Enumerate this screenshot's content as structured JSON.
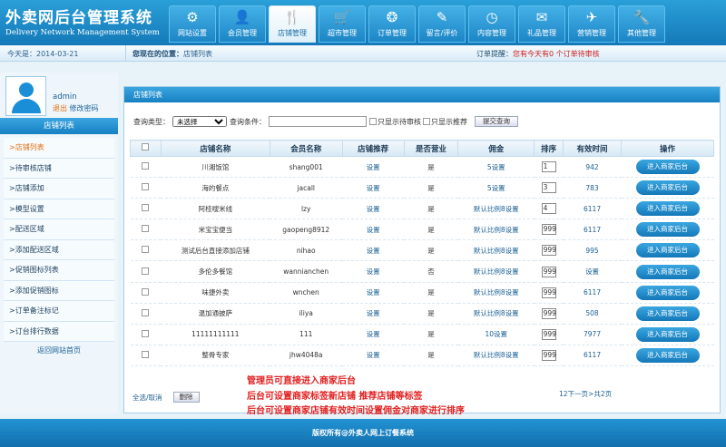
{
  "header": {
    "title": "外卖网后台管理系统",
    "subtitle": "Delivery Network Management System",
    "nav": [
      {
        "label": "网站设置",
        "icon": "gear-icon",
        "glyph": "⚙"
      },
      {
        "label": "会员管理",
        "icon": "user-icon",
        "glyph": "👤"
      },
      {
        "label": "店铺管理",
        "icon": "store-icon",
        "glyph": "🍴",
        "active": true
      },
      {
        "label": "超市管理",
        "icon": "cart-icon",
        "glyph": "🛒"
      },
      {
        "label": "订单管理",
        "icon": "film-icon",
        "glyph": "❂"
      },
      {
        "label": "留言/评价",
        "icon": "message-icon",
        "glyph": "✎"
      },
      {
        "label": "内容管理",
        "icon": "clock-icon",
        "glyph": "◷"
      },
      {
        "label": "礼品管理",
        "icon": "mail-icon",
        "glyph": "✉"
      },
      {
        "label": "营销管理",
        "icon": "plane-icon",
        "glyph": "✈"
      },
      {
        "label": "其他管理",
        "icon": "wrench-icon",
        "glyph": "🔧"
      }
    ]
  },
  "subbar": {
    "date": "今天是：2014-03-21",
    "location_label": "您现在的位置：",
    "location": "店铺列表",
    "notice_prefix": "订单提醒：",
    "notice": "您有今天有0 个订单待审核"
  },
  "sidebar": {
    "username": "admin",
    "logout": "退出",
    "change_password": "修改密码",
    "title": "店铺列表",
    "items": [
      {
        "label": ">店铺列表",
        "active": true
      },
      {
        "label": ">待审核店铺"
      },
      {
        "label": ">店铺添加"
      },
      {
        "label": ">模型设置"
      },
      {
        "label": ">配送区域"
      },
      {
        "label": ">添加配送区域"
      },
      {
        "label": ">促销图标列表"
      },
      {
        "label": ">添加促销图标"
      },
      {
        "label": ">订单备注标记"
      },
      {
        "label": ">订台排行数据"
      }
    ],
    "footer": "返回网站首页"
  },
  "panel": {
    "title": "店铺列表",
    "filter": {
      "type_label": "查询类型：",
      "type_value": "未选择",
      "cond_label": "查询条件：",
      "cond_value": "",
      "only_pending": "只显示待审核",
      "only_recommended": "只显示推荐",
      "query_button": "提交查询"
    },
    "columns": [
      "店铺名称",
      "会员名称",
      "店铺推荐",
      "是否营业",
      "佣金",
      "排序",
      "有效时间",
      "操作"
    ],
    "rows": [
      {
        "shop": "川湘饭馆",
        "member": "shang001",
        "recommend": "设置",
        "open": "是",
        "commission": "5设置",
        "sort": "1",
        "valid": "942"
      },
      {
        "shop": "海的餐点",
        "member": "jacall",
        "recommend": "设置",
        "open": "是",
        "commission": "5设置",
        "sort": "3",
        "valid": "783"
      },
      {
        "shop": "阿桂嗖米线",
        "member": "lzy",
        "recommend": "设置",
        "open": "是",
        "commission": "默认比例8设置",
        "sort": "4",
        "valid": "6117"
      },
      {
        "shop": "米宝宝便当",
        "member": "gaopeng8912",
        "recommend": "设置",
        "open": "是",
        "commission": "默认比例8设置",
        "sort": "999",
        "valid": "6117"
      },
      {
        "shop": "测试后台直接添加店铺",
        "member": "nihao",
        "recommend": "设置",
        "open": "是",
        "commission": "默认比例8设置",
        "sort": "999",
        "valid": "995"
      },
      {
        "shop": "多伦多餐馆",
        "member": "wannianchen",
        "recommend": "设置",
        "open": "否",
        "commission": "默认比例8设置",
        "sort": "999",
        "valid": "设置"
      },
      {
        "shop": "味捷外卖",
        "member": "wnchen",
        "recommend": "设置",
        "open": "是",
        "commission": "默认比例8设置",
        "sort": "999",
        "valid": "6117"
      },
      {
        "shop": "温加通披萨",
        "member": "iliya",
        "recommend": "设置",
        "open": "是",
        "commission": "默认比例8设置",
        "sort": "999",
        "valid": "508"
      },
      {
        "shop": "11111111111",
        "member": "111",
        "recommend": "设置",
        "open": "是",
        "commission": "10设置",
        "sort": "999",
        "valid": "7977"
      },
      {
        "shop": "整骨专家",
        "member": "jhw4048a",
        "recommend": "设置",
        "open": "是",
        "commission": "默认比例8设置",
        "sort": "999",
        "valid": "6117"
      }
    ],
    "enter_button": "进入商家后台",
    "select_all": "全选/取消",
    "delete_button": "删除",
    "pager": "12下一页>共2页"
  },
  "notes": [
    "管理员可直接进入商家后台",
    "后台可设置商家标签新店铺 推荐店铺等标签",
    "后台可设置商家店铺有效时间设置佣金对商家进行排序"
  ],
  "footer": "版权所有@外卖人网上订餐系统"
}
